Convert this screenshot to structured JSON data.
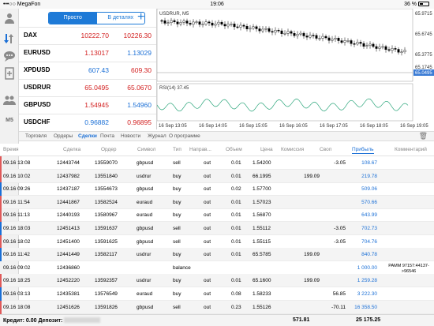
{
  "status_bar": {
    "carrier": "•••○○ MegaFon",
    "time": "19:06",
    "battery": "36 %"
  },
  "sidebar": {
    "items": [
      "person-icon",
      "trade-icon",
      "chat-icon",
      "document-icon",
      "people-icon"
    ],
    "m5": "M5"
  },
  "quotes": {
    "tabs": [
      "Просто",
      "В деталях"
    ],
    "rows": [
      {
        "symbol": "DAX",
        "bid": "10222.70",
        "ask": "10226.30",
        "color": "red"
      },
      {
        "symbol": "EURUSD",
        "bid": "1.13017",
        "ask": "1.13029",
        "color": "mixed"
      },
      {
        "symbol": "XPDUSD",
        "bid": "607.43",
        "ask": "609.30",
        "color": "blue"
      },
      {
        "symbol": "USDRUR",
        "bid": "65.0495",
        "ask": "65.0670",
        "color": "red"
      },
      {
        "symbol": "GBPUSD",
        "bid": "1.54945",
        "ask": "1.54960",
        "color": "mixed"
      },
      {
        "symbol": "USDCHF",
        "bid": "0.96882",
        "ask": "0.96895",
        "color": "mixed"
      }
    ]
  },
  "chart": {
    "title": "USDRUR, M5",
    "price_ticks": [
      "65.9715",
      "65.6745",
      "65.3775",
      "65.1745",
      "65.0495"
    ],
    "rsi_label": "RSI(14) 37.45",
    "time_ticks": [
      "16 Sep 13:05",
      "16 Sep 14:05",
      "16 Sep 15:05",
      "16 Sep 16:05",
      "16 Sep 17:05",
      "16 Sep 18:05",
      "16 Sep 19:05"
    ]
  },
  "tabs": {
    "items": [
      "Торговля",
      "Ордеры",
      "Сделки",
      "Почта",
      "Новости",
      "Журнал",
      "О программе"
    ],
    "active": "Сделки"
  },
  "table": {
    "headers": [
      "Время",
      "Сделка",
      "Ордер",
      "Символ",
      "Тип",
      "Направ...",
      "Объем",
      "Цена",
      "Комиссия",
      "Своп",
      "Прибыль",
      "Комментарий"
    ],
    "rows": [
      {
        "time": "09.16 13:08",
        "deal": "12443744",
        "order": "13559070",
        "symbol": "gbpusd",
        "type": "sell",
        "dir": "out",
        "vol": "0.01",
        "price": "1.54200",
        "comm": "",
        "swap": "-3.05",
        "profit": "108.67",
        "comment": ""
      },
      {
        "time": "09.16 10:02",
        "deal": "12437982",
        "order": "13551840",
        "symbol": "usdrur",
        "type": "buy",
        "dir": "out",
        "vol": "0.01",
        "price": "66.1995",
        "comm": "199.09",
        "swap": "",
        "profit": "219.78",
        "comment": ""
      },
      {
        "time": "09.16 09:26",
        "deal": "12437187",
        "order": "13554673",
        "symbol": "gbpusd",
        "type": "buy",
        "dir": "out",
        "vol": "0.02",
        "price": "1.57700",
        "comm": "",
        "swap": "",
        "profit": "509.06",
        "comment": ""
      },
      {
        "time": "09.16 11:54",
        "deal": "12441867",
        "order": "13582524",
        "symbol": "euraud",
        "type": "buy",
        "dir": "out",
        "vol": "0.01",
        "price": "1.57023",
        "comm": "",
        "swap": "",
        "profit": "570.66",
        "comment": ""
      },
      {
        "time": "09.16 11:13",
        "deal": "12440193",
        "order": "13580967",
        "symbol": "euraud",
        "type": "buy",
        "dir": "out",
        "vol": "0.01",
        "price": "1.56870",
        "comm": "",
        "swap": "",
        "profit": "643.99",
        "comment": ""
      },
      {
        "time": "09.16 18:03",
        "deal": "12451413",
        "order": "13591637",
        "symbol": "gbpusd",
        "type": "sell",
        "dir": "out",
        "vol": "0.01",
        "price": "1.55112",
        "comm": "",
        "swap": "-3.05",
        "profit": "702.73",
        "comment": ""
      },
      {
        "time": "09.16 18:02",
        "deal": "12451400",
        "order": "13591625",
        "symbol": "gbpusd",
        "type": "sell",
        "dir": "out",
        "vol": "0.01",
        "price": "1.55115",
        "comm": "",
        "swap": "-3.05",
        "profit": "704.76",
        "comment": ""
      },
      {
        "time": "09.16 11:42",
        "deal": "12441449",
        "order": "13582117",
        "symbol": "usdrur",
        "type": "buy",
        "dir": "out",
        "vol": "0.01",
        "price": "65.5785",
        "comm": "199.09",
        "swap": "",
        "profit": "840.78",
        "comment": ""
      },
      {
        "time": "09.16 09:02",
        "deal": "12436860",
        "order": "",
        "symbol": "",
        "type": "balance",
        "dir": "",
        "vol": "",
        "price": "",
        "comm": "",
        "swap": "",
        "profit": "1 000.00",
        "comment": "PAMM 97157:44137->96546"
      },
      {
        "time": "09.16 18:25",
        "deal": "12452220",
        "order": "13592357",
        "symbol": "usdrur",
        "type": "buy",
        "dir": "out",
        "vol": "0.01",
        "price": "65.1600",
        "comm": "199.09",
        "swap": "",
        "profit": "1 259.28",
        "comment": ""
      },
      {
        "time": "09.16 03:13",
        "deal": "12435381",
        "order": "13576549",
        "symbol": "euraud",
        "type": "buy",
        "dir": "out",
        "vol": "0.08",
        "price": "1.58233",
        "comm": "",
        "swap": "56.85",
        "profit": "3 222.30",
        "comment": ""
      },
      {
        "time": "09.16 18:08",
        "deal": "12451626",
        "order": "13591826",
        "symbol": "gbpusd",
        "type": "sell",
        "dir": "out",
        "vol": "0.23",
        "price": "1.55126",
        "comm": "",
        "swap": "-70.11",
        "profit": "16 358.50",
        "comment": ""
      }
    ],
    "row_bar_colors": [
      "#e05a5a",
      "#e05a5a",
      "#1a6fd6",
      "#e05a5a",
      "#e05a5a",
      "#1a6fd6",
      "#e05a5a",
      "#1a6fd6",
      "",
      "#e05a5a",
      "#1a6fd6",
      "#e05a5a"
    ]
  },
  "footer": {
    "label": "Кредит: 0.00 Депозит:",
    "commission_total": "571.81",
    "profit_total": "25 175.25"
  }
}
